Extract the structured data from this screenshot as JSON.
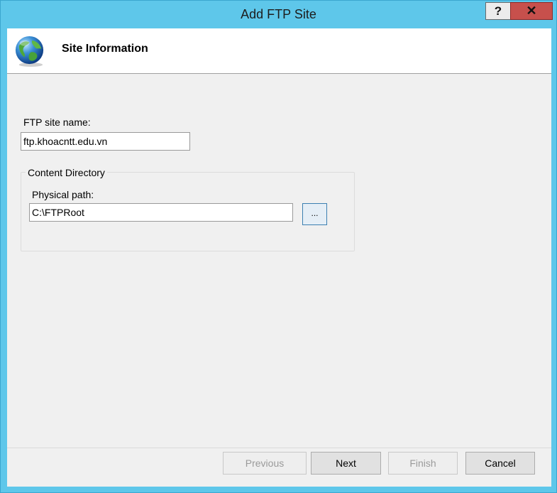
{
  "window": {
    "title": "Add FTP Site",
    "help_label": "?",
    "close_label": "✕"
  },
  "header": {
    "title": "Site Information",
    "icon": "globe-icon"
  },
  "form": {
    "site_name_label": "FTP site name:",
    "site_name_value": "ftp.khoacntt.edu.vn",
    "content_directory": {
      "title": "Content Directory",
      "physical_path_label": "Physical path:",
      "physical_path_value": "C:\\FTPRoot",
      "browse_label": "..."
    }
  },
  "footer": {
    "previous": "Previous",
    "next": "Next",
    "finish": "Finish",
    "cancel": "Cancel"
  },
  "colors": {
    "frame": "#5ec7ea",
    "close_button": "#c7504c",
    "focus_border": "#3c7fb1"
  }
}
